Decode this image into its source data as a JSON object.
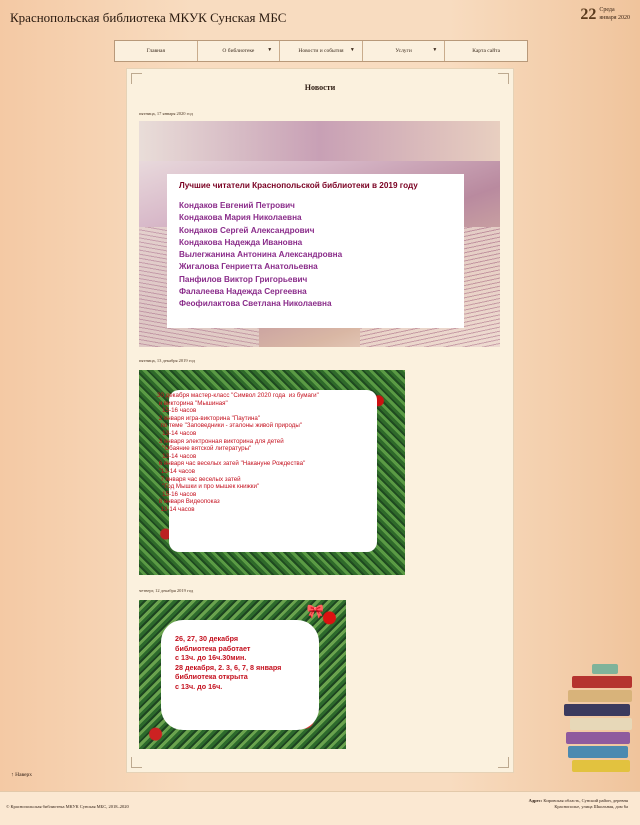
{
  "header": {
    "site_title": "Краснопольская библиотека МКУК Сунская МБС",
    "date_day": "22",
    "date_weekday": "Среда",
    "date_month_year": "января 2020"
  },
  "nav": {
    "items": [
      {
        "label": "Главная"
      },
      {
        "label": "О библиотеке"
      },
      {
        "label": "Новости и события"
      },
      {
        "label": "Услуги"
      },
      {
        "label": "Карта сайта"
      }
    ],
    "caret": "▼"
  },
  "main": {
    "title": "Новости",
    "posts": [
      {
        "date": "пятница, 17 января 2020 год",
        "heading": "Лучшие читатели Краснопольской библиотеки в 2019 году",
        "names": [
          "Кондаков Евгений Петрович",
          "Кондакова Мария Николаевна",
          "Кондаков Сергей Александрович",
          "Кондакова Надежда Ивановна",
          "Вылегжанина Антонина Александровна",
          "Жигалова Генриетта Анатольевна",
          "Панфилов Виктор Григорьевич",
          "Фалалеева Надежда Сергеевна",
          "Феофилактова Светлана Николаевна"
        ]
      },
      {
        "date": "пятница, 13 декабря 2019 год",
        "lines": [
          "30 декабря мастер-класс \"Символ 2020 года  из бумаги\"",
          " и викторина \"Мышиная\"",
          "   15-16 часов",
          " 2 января игра-викторина \"Паутина\"",
          "  по теме \"Заповедники - эталоны живой природы\"",
          "   13-14 часов",
          " 3 января электронная викторина для детей",
          "   \"Обаяние вятской литературы\"",
          "   13-14 часов",
          " 6 января час веселых затей \"Накануне Рождества\"",
          " \"13-14 часов",
          "  7 января час веселых затей",
          "   \"Год Мышки и про мышек книжки\"",
          "   15-16 часов",
          " 8 января Видеопоказ",
          "  13-14 часов"
        ]
      },
      {
        "date": "четверг, 12 декабря 2019 год",
        "lines": [
          "26, 27, 30 декабря",
          "библиотека работает",
          "с 13ч. до 16ч.30мин.",
          "28 декабря, 2. 3, 6, 7, 8 января",
          "библиотека открыта",
          "с 13ч. до 16ч."
        ]
      }
    ]
  },
  "back_label": "↑ Наверх",
  "footer": {
    "copyright": "© Краснопольская библиотека МКУК Сунская МБС, 2018–2020",
    "address_label": "Адрес:",
    "address_text": "Кировская область, Сунский район, деревня Краснополье, улица Школьная, дом 6а"
  },
  "colors": {
    "accent_title": "#7a0022",
    "names": "#8a2c8a",
    "announce": "#c4101e"
  }
}
